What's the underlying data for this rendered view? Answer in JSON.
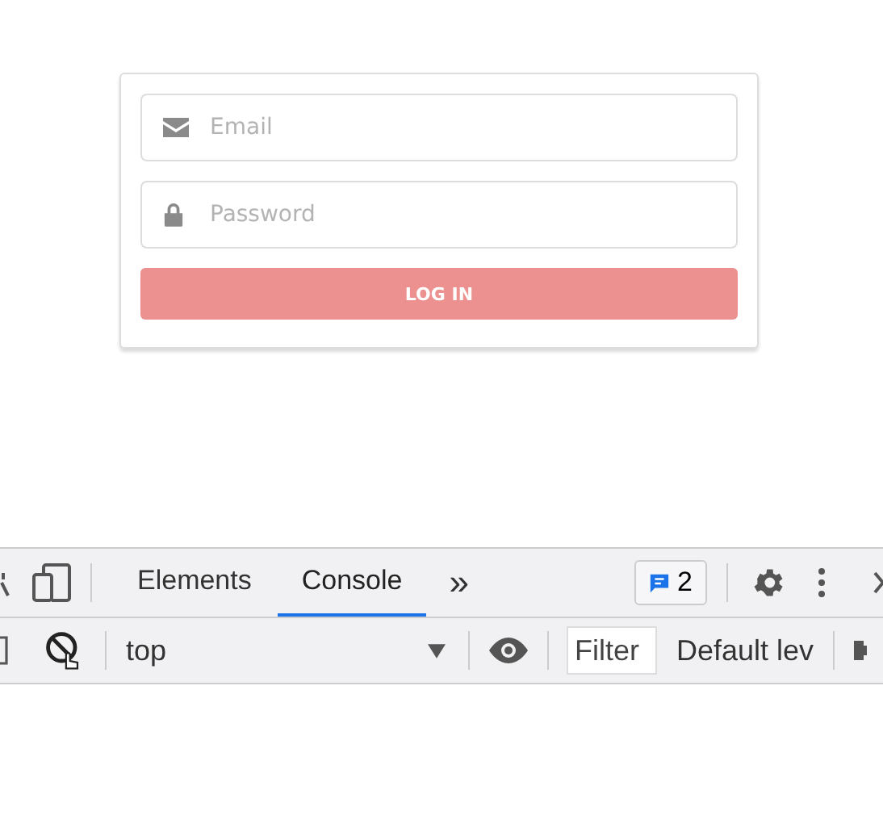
{
  "login_form": {
    "email": {
      "placeholder": "Email"
    },
    "password": {
      "placeholder": "Password"
    },
    "submit": "LOG IN"
  },
  "devtools": {
    "tabs": [
      {
        "label": "Elements",
        "selected": false
      },
      {
        "label": "Console",
        "selected": true
      }
    ],
    "more_tabs": "»",
    "issues_count": "2",
    "context": "top",
    "filter": {
      "placeholder": "Filter"
    },
    "levels": "Default lev"
  }
}
